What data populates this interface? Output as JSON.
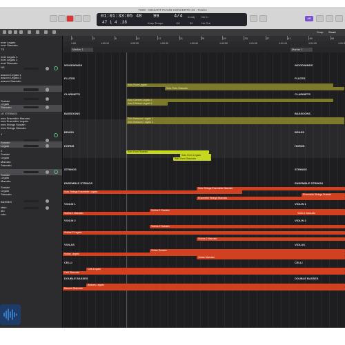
{
  "window": {
    "title": "TMW - MOZART PIANO CONCERTO 23 - Tracks"
  },
  "lcd": {
    "position": "01:01:33:05",
    "bars": "47 1 4 .38",
    "beat": "48",
    "tempo": "99",
    "tempo_mode": "Keep Tempo",
    "signature": "4/4",
    "division": "/16",
    "key": "A maj",
    "num50": "50",
    "in": "No In",
    "out": "No Out"
  },
  "toolbar_right": {
    "badge": "AB",
    "snap": "Snap:",
    "mode": "Smart"
  },
  "ruler": {
    "bars": [
      "1",
      "5",
      "9",
      "13",
      "17",
      "21",
      "25",
      "29",
      "33",
      "37",
      "41",
      "45",
      "49"
    ],
    "times": [
      "1:00",
      "1:00:10",
      "1:00:20",
      "1:00:30",
      "1:00:40",
      "1:00:50",
      "1:01:00",
      "1:01:10",
      "1:01:20",
      "1:01:30"
    ],
    "markers": [
      "Marker 1",
      "Marker 1"
    ]
  },
  "sidebar": [
    "nner Legato",
    "nner Staccato",
    "TS",
    "rinet Legato 1",
    "rinet Legato 2",
    "rinet Staccato",
    "NS",
    "assoon Legato 1",
    "assoon Legato 2",
    "assoon Staccato",
    "Sustain",
    "Legato",
    "Staccato",
    "LE STRINGS",
    "mes Ensemble Marcato",
    "mes Ensemble Legato",
    "mes Strings Sustain",
    "mes Strings Marcato",
    "1",
    "Sustain",
    "Legato",
    "2",
    "Sustain",
    "Legato",
    "Marcato",
    "Staccato",
    "Sustain",
    "Legato",
    "Marcato",
    "Sustain",
    "Legato",
    "Staccato",
    "BASSES",
    "stain",
    "ato",
    "cato"
  ],
  "groups": {
    "woodwinds": "WOODWINDS",
    "flutes": "FLUTES",
    "clarinets": "CLARINETS",
    "bassoons": "BASSOONS",
    "brass": "BRASS",
    "horns": "HORNS",
    "strings": "STRINGS",
    "ensemble": "ENSEMBLE STRINGS",
    "violin1": "VIOLIN 1",
    "violin2": "VIOLIN 2",
    "violas": "VIOLAS",
    "celli": "CELLI",
    "basses": "DOUBLE BASSES"
  },
  "regions": {
    "flute_legato": "Solo Flute Legato",
    "flute_staccato": "Solo Flute Staccato",
    "clar_legato1": "Solo Clarinet Legato 1",
    "clar_legato2": "Solo Clarinet Legato 2",
    "bassoon_legato1": "Solo Bassoon Legato 1",
    "bassoon_legato2": "Solo Bassoon Legato 2",
    "horn_a": "Solo Horn Sustain",
    "horn_b": "Solo Horn Legato",
    "horn_c": "Solo Horn Staccato",
    "ens_marcato": "Solo Strings Ensemble Marcato",
    "ens_legato": "Solo Strings Ensemble Legato",
    "ens_sustain": "Ensemble Strings Sustain",
    "ens_marc2": "Ensemble Strings Marcato",
    "v1_marcato": "Violins 1 Marcato",
    "v1_sustain": "Violins 1 Sustain",
    "v1_marcato2": "Violin 1 Marcato",
    "v2_sustain": "Violins 2 Sustain",
    "v2_legato": "Violins 2 Legato",
    "v2_marcato": "Violins 2 Marcato",
    "va_sustain": "Violas Sustain",
    "va_legato": "Violas Legato",
    "va_marcato": "Violas Marcato",
    "vc_legato": "Celli Legato",
    "vc_staccato": "Celli Staccato",
    "cb_legato": "Basses Legato",
    "cb_staccato": "Basses Staccato"
  },
  "colors": {
    "strings": "#d2411f",
    "woodwinds": "#7c7a2a",
    "brass": "#c6d71f"
  }
}
